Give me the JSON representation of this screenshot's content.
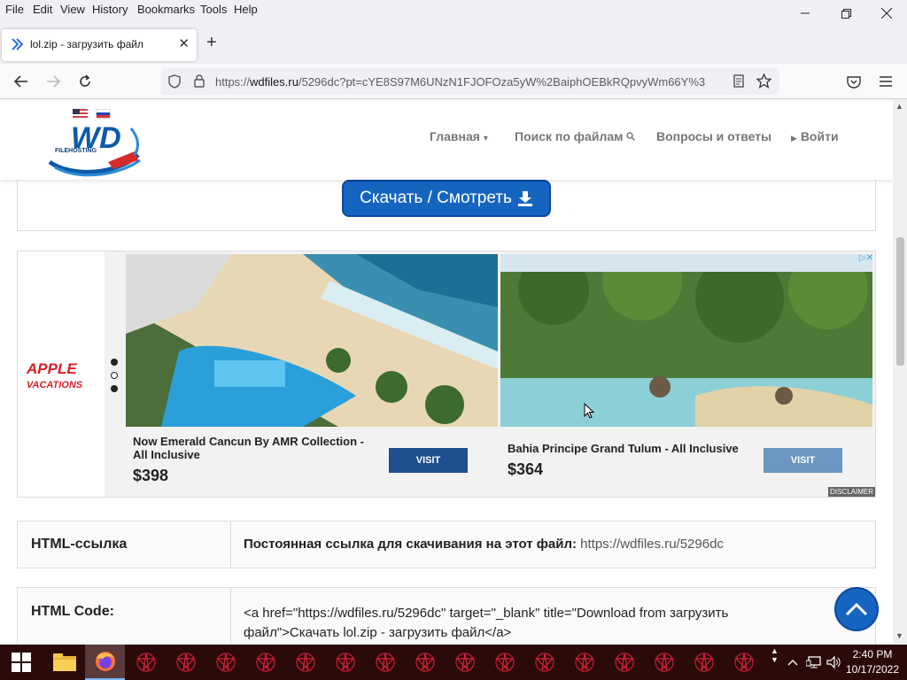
{
  "menu": {
    "file": "File",
    "edit": "Edit",
    "view": "View",
    "history": "History",
    "bookmarks": "Bookmarks",
    "tools": "Tools",
    "help": "Help"
  },
  "tab": {
    "title": "lol.zip - загрузить файл"
  },
  "urlbar": {
    "prefix": "https://",
    "domain": "wdfiles.ru",
    "path": "/5296dc?pt=cYE8S97M6UNzN1FJOFOza5yW%2BaiphOEBkRQpvyWm66Y%3"
  },
  "site": {
    "menu": [
      "Главная",
      "Поиск по файлам",
      "Вопросы и ответы",
      "Войти"
    ],
    "logo_text": "WD",
    "logo_sub": "FILEHOSTING",
    "download_button": "Скачать / Смотреть"
  },
  "ad": {
    "brand_line1": "APPLE",
    "brand_line2": "VACATIONS",
    "cards": [
      {
        "name": "Now Emerald Cancun By AMR Collection - All Inclusive",
        "price": "$398",
        "button": "VISIT",
        "button_color": "#1d4f91"
      },
      {
        "name": "Bahia Principe Grand Tulum - All Inclusive",
        "price": "$364",
        "button": "VISIT",
        "button_color": "#6c97c1"
      }
    ],
    "disclaimer": "DISCLAIMER"
  },
  "table": {
    "row1_label": "HTML-ссылка",
    "row1_bold": "Постоянная ссылка для скачивания на этот файл:",
    "row1_link": "https://wdfiles.ru/5296dc",
    "row2_label": "HTML Code:",
    "row2_value": "<a href=\"https://wdfiles.ru/5296dc\" target=\"_blank\" title=\"Download from загрузить файл\">Скачать lol.zip - загрузить файл</a>"
  },
  "taskbar": {
    "time": "2:40 PM",
    "date": "10/17/2022"
  }
}
